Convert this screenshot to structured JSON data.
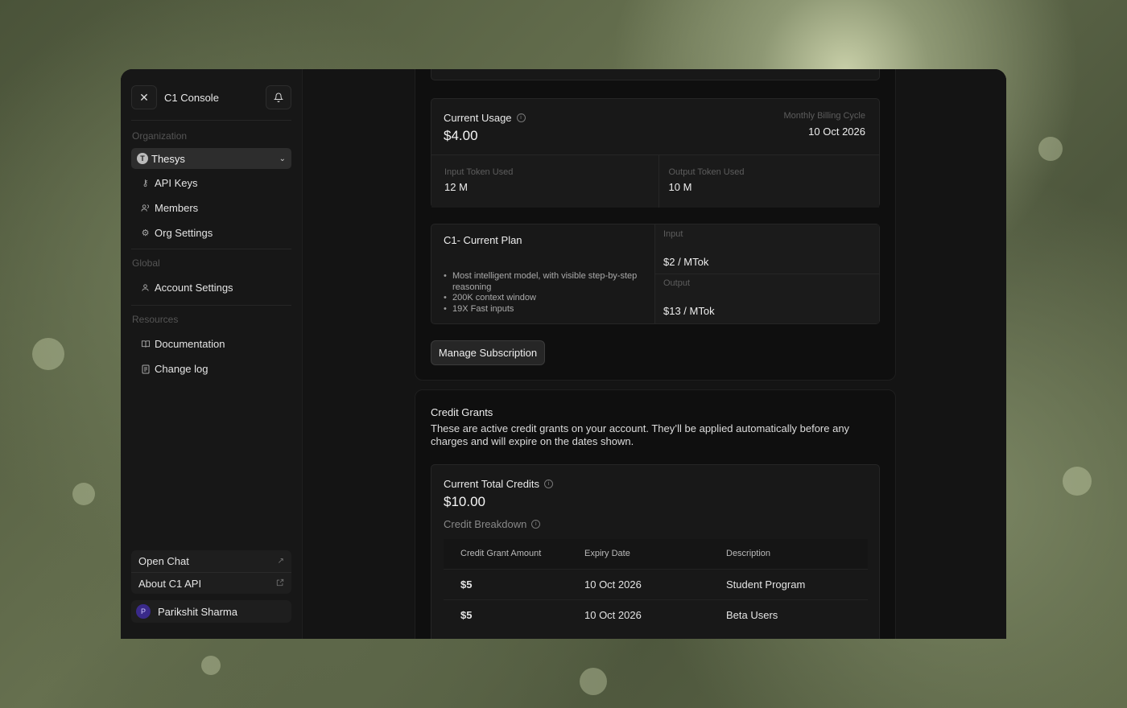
{
  "sidebar": {
    "title": "C1 Console",
    "org_label": "Organization",
    "org_name": "Thesys",
    "org_logo_letter": "T",
    "org_items": [
      {
        "label": "API Keys",
        "icon": "key-icon"
      },
      {
        "label": "Members",
        "icon": "users-icon"
      },
      {
        "label": "Org Settings",
        "icon": "gear-icon"
      }
    ],
    "global_label": "Global",
    "global_items": [
      {
        "label": "Account Settings",
        "icon": "user-icon"
      }
    ],
    "resources_label": "Resources",
    "resource_items": [
      {
        "label": "Documentation",
        "icon": "book-icon"
      },
      {
        "label": "Change log",
        "icon": "file-icon"
      }
    ],
    "bottom_links": [
      {
        "label": "Open Chat",
        "icon": "arrow-up-right-icon"
      },
      {
        "label": "About C1 API",
        "icon": "external-link-icon"
      }
    ],
    "user": {
      "initial": "P",
      "name": "Parikshit Sharma"
    }
  },
  "usage": {
    "title": "Current Usage",
    "amount": "$4.00",
    "cycle_label": "Monthly Billing Cycle",
    "cycle_date": "10 Oct 2026",
    "input_label": "Input Token Used",
    "input_value": "12 M",
    "output_label": "Output Token Used",
    "output_value": "10 M"
  },
  "plan": {
    "title": "C1- Current Plan",
    "features": [
      "Most intelligent model, with visible step-by-step reasoning",
      "200K context window",
      "19X Fast inputs"
    ],
    "input_label": "Input",
    "input_price": "$2 / MTok",
    "output_label": "Output",
    "output_price": "$13 / MTok",
    "manage_button": "Manage Subscription"
  },
  "credits": {
    "title": "Credit Grants",
    "description": "These are active credit grants on your account. They’ll be applied automatically before any charges and will expire on the dates shown.",
    "total_label": "Current Total Credits",
    "total_amount": "$10.00",
    "breakdown_label": "Credit Breakdown",
    "columns": [
      "Credit Grant Amount",
      "Expiry Date",
      "Description"
    ],
    "rows": [
      [
        "$5",
        "10 Oct 2026",
        "Student Program"
      ],
      [
        "$5",
        "10 Oct 2026",
        "Beta Users"
      ]
    ]
  }
}
